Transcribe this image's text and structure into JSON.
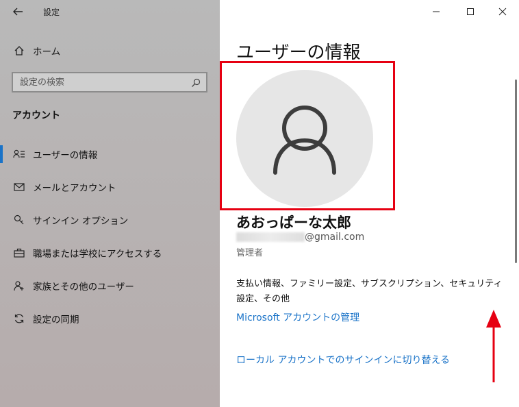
{
  "window": {
    "app_title": "設定",
    "back_icon": "back-arrow-icon",
    "controls": {
      "minimize": "—",
      "maximize": "☐",
      "close": "✕"
    }
  },
  "sidebar": {
    "home_label": "ホーム",
    "search_placeholder": "設定の検索",
    "section_title": "アカウント",
    "items": [
      {
        "label": "ユーザーの情報",
        "icon": "user-info-icon",
        "selected": true
      },
      {
        "label": "メールとアカウント",
        "icon": "mail-icon"
      },
      {
        "label": "サインイン オプション",
        "icon": "key-icon"
      },
      {
        "label": "職場または学校にアクセスする",
        "icon": "briefcase-icon"
      },
      {
        "label": "家族とその他のユーザー",
        "icon": "family-icon"
      },
      {
        "label": "設定の同期",
        "icon": "sync-icon"
      }
    ]
  },
  "main": {
    "title": "ユーザーの情報",
    "avatar_icon": "user-avatar-icon",
    "user_name": "あおっぱーな太郎",
    "email_suffix": "@gmail.com",
    "role": "管理者",
    "description": "支払い情報、ファミリー設定、サブスクリプション、セキュリティ設定、その他",
    "manage_link": "Microsoft アカウントの管理",
    "local_link": "ローカル アカウントでのサインインに切り替える"
  },
  "colors": {
    "accent": "#1a73c8",
    "highlight": "#e60012"
  }
}
